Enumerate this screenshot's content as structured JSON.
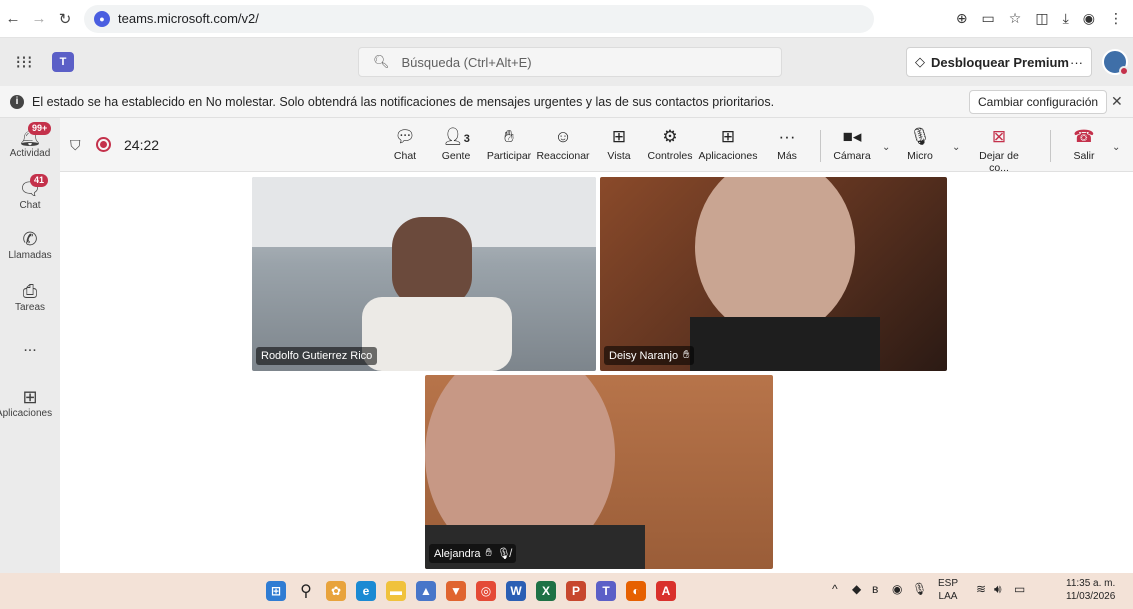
{
  "browser": {
    "url": "teams.microsoft.com/v2/"
  },
  "header": {
    "search_placeholder": "Búsqueda (Ctrl+Alt+E)",
    "premium_label": "Desbloquear Premium"
  },
  "banner": {
    "message": "El estado se ha establecido en No molestar. Solo obtendrá las notificaciones de mensajes urgentes y las de sus contactos prioritarios.",
    "button_label": "Cambiar configuración"
  },
  "rail": {
    "items": [
      {
        "label": "Actividad",
        "badge": "99+"
      },
      {
        "label": "Chat",
        "badge": "41"
      },
      {
        "label": "Llamadas"
      },
      {
        "label": "Tareas"
      },
      {
        "label": "..."
      },
      {
        "label": "Aplicaciones"
      }
    ]
  },
  "meeting": {
    "timer": "24:22",
    "participant_count": "3",
    "tools": {
      "chat": "Chat",
      "people": "Gente",
      "raise": "Participar",
      "react": "Reaccionar",
      "view": "Vista",
      "controls": "Controles",
      "apps": "Aplicaciones",
      "more": "Más",
      "camera": "Cámara",
      "mic": "Micro",
      "share": "Dejar de co...",
      "leave": "Salir"
    }
  },
  "participants": [
    {
      "name": "Rodolfo Gutierrez Rico"
    },
    {
      "name": "Deisy Naranjo"
    },
    {
      "name": "Alejandra"
    }
  ],
  "taskbar": {
    "lang_top": "ESP",
    "lang_bottom": "LAA",
    "time": "11:35 a. m.",
    "date": "11/03/2026"
  },
  "colors": {
    "accent": "#5b5fc7",
    "recording": "#c4314b",
    "leave": "#c4314b",
    "taskbar": "#f3e2d7"
  }
}
